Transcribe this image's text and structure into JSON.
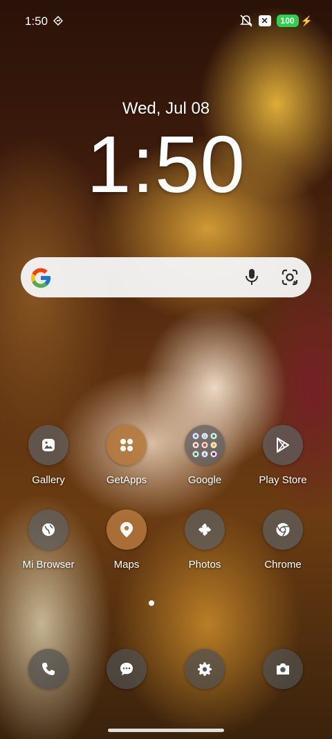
{
  "status_bar": {
    "time": "1:50",
    "battery_level": "100",
    "icons": [
      "location-diamond-icon",
      "mute-icon",
      "x-notification-icon",
      "charging-icon"
    ]
  },
  "lockscreen": {
    "date": "Wed, Jul 08",
    "clock": "1:50"
  },
  "search_bar": {
    "icons": [
      "google-g-icon",
      "microphone-icon",
      "google-lens-icon"
    ]
  },
  "apps": [
    {
      "label": "Gallery",
      "icon": "gallery-icon"
    },
    {
      "label": "GetApps",
      "icon": "getapps-icon"
    },
    {
      "label": "Google",
      "icon": "google-folder-icon"
    },
    {
      "label": "Play Store",
      "icon": "play-store-icon"
    },
    {
      "label": "Mi Browser",
      "icon": "globe-icon"
    },
    {
      "label": "Maps",
      "icon": "map-pin-icon"
    },
    {
      "label": "Photos",
      "icon": "pinwheel-icon"
    },
    {
      "label": "Chrome",
      "icon": "chrome-icon"
    }
  ],
  "dock": [
    {
      "icon": "phone-icon"
    },
    {
      "icon": "messages-icon"
    },
    {
      "icon": "settings-gear-icon"
    },
    {
      "icon": "camera-icon"
    }
  ],
  "page_indicator": {
    "current": 1,
    "total": 1
  }
}
